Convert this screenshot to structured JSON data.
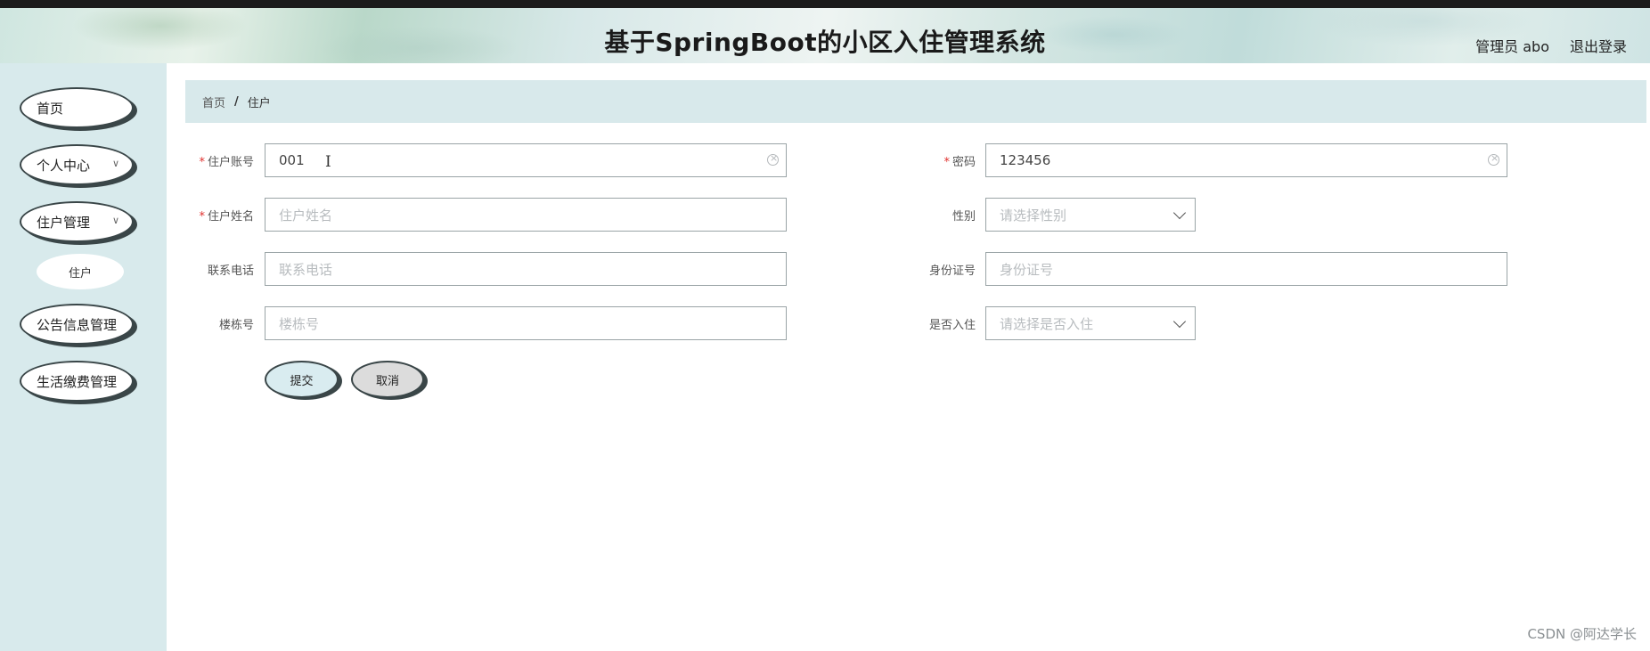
{
  "header": {
    "title": "基于SpringBoot的小区入住管理系统",
    "user_label": "管理员 abo",
    "logout_label": "退出登录"
  },
  "sidebar": {
    "items": [
      {
        "label": "首页"
      },
      {
        "label": "个人中心"
      },
      {
        "label": "住户管理"
      },
      {
        "label": "住户"
      },
      {
        "label": "公告信息管理"
      },
      {
        "label": "生活缴费管理"
      }
    ]
  },
  "breadcrumb": {
    "home": "首页",
    "separator": "/",
    "current": "住户"
  },
  "form": {
    "account": {
      "label": "住户账号",
      "value": "001"
    },
    "password": {
      "label": "密码",
      "value": "123456"
    },
    "name": {
      "label": "住户姓名",
      "placeholder": "住户姓名"
    },
    "gender": {
      "label": "性别",
      "placeholder": "请选择性别"
    },
    "phone": {
      "label": "联系电话",
      "placeholder": "联系电话"
    },
    "id_number": {
      "label": "身份证号",
      "placeholder": "身份证号"
    },
    "building": {
      "label": "楼栋号",
      "placeholder": "楼栋号"
    },
    "moved_in": {
      "label": "是否入住",
      "placeholder": "请选择是否入住"
    },
    "required_mark": "*",
    "submit_label": "提交",
    "cancel_label": "取消"
  },
  "watermark": "CSDN @阿达学长"
}
